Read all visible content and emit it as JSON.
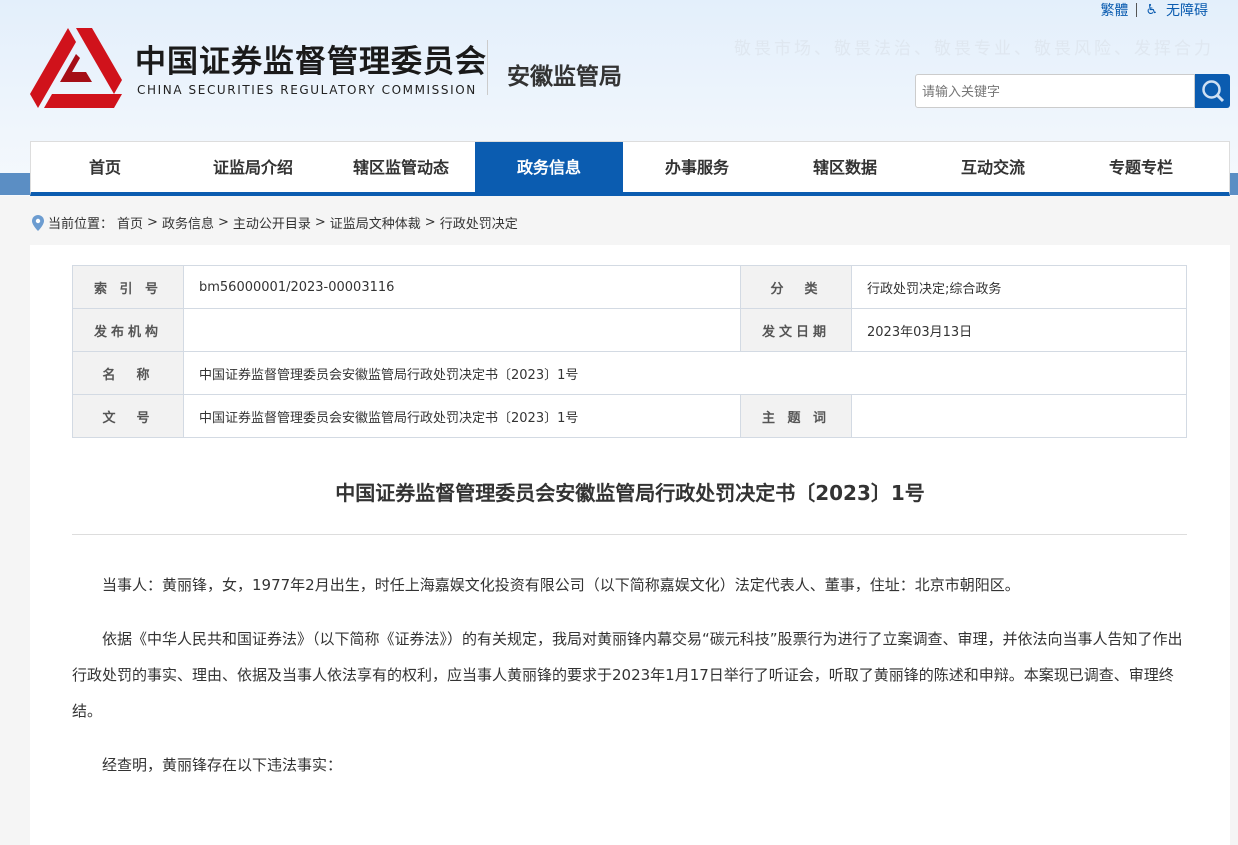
{
  "header": {
    "org_cn": "中国证券监督管理委员会",
    "org_en": "CHINA SECURITIES REGULATORY COMMISSION",
    "bureau": "安徽监管局",
    "slogan": "敬畏市场、敬畏法治、敬畏专业、敬畏风险、发挥合力",
    "traditional": "繁體",
    "accessibility": "无障碍",
    "search_placeholder": "请输入关键字"
  },
  "nav": [
    "首页",
    "证监局介绍",
    "辖区监管动态",
    "政务信息",
    "办事服务",
    "辖区数据",
    "互动交流",
    "专题专栏"
  ],
  "breadcrumb": {
    "label": "当前位置：",
    "items": [
      "首页",
      "政务信息",
      "主动公开目录",
      "证监局文种体裁",
      "行政处罚决定"
    ],
    "sep": ">"
  },
  "meta": {
    "index_label": "索 引 号",
    "index": "bm56000001/2023-00003116",
    "category_label": "分　类",
    "category": "行政处罚决定;综合政务",
    "publisher_label": "发布机构",
    "publisher": "",
    "date_label": "发文日期",
    "date": "2023年03月13日",
    "name_label": "名　称",
    "name": "中国证券监督管理委员会安徽监管局行政处罚决定书〔2023〕1号",
    "docno_label": "文　号",
    "docno": "中国证券监督管理委员会安徽监管局行政处罚决定书〔2023〕1号",
    "keywords_label": "主 题 词",
    "keywords": ""
  },
  "article": {
    "title": "中国证券监督管理委员会安徽监管局行政处罚决定书〔2023〕1号",
    "paragraphs": [
      "当事人：黄丽锋，女，1977年2月出生，时任上海嘉娱文化投资有限公司（以下简称嘉娱文化）法定代表人、董事，住址：北京市朝阳区。",
      "依据《中华人民共和国证券法》（以下简称《证券法》）的有关规定，我局对黄丽锋内幕交易“碳元科技”股票行为进行了立案调查、审理，并依法向当事人告知了作出行政处罚的事实、理由、依据及当事人依法享有的权利，应当事人黄丽锋的要求于2023年1月17日举行了听证会，听取了黄丽锋的陈述和申辩。本案现已调查、审理终结。",
      "经查明，黄丽锋存在以下违法事实："
    ]
  }
}
